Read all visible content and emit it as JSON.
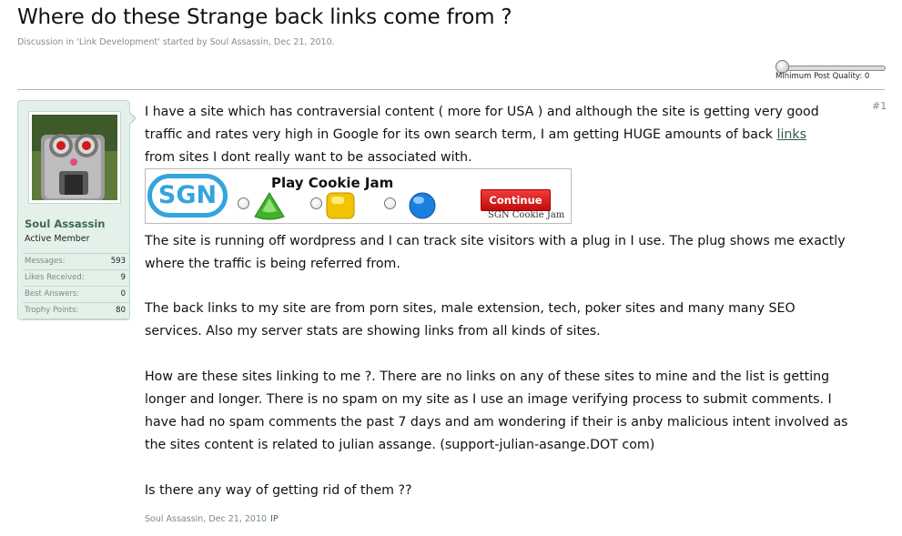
{
  "thread": {
    "title": "Where do these Strange back links come from ?",
    "subline": "Discussion in 'Link Development' started by Soul Assassin, Dec 21, 2010."
  },
  "quality_slider": {
    "label": "Minimum Post Quality: 0",
    "value": 0
  },
  "post": {
    "number": "#1",
    "author": {
      "name": "Soul Assassin",
      "title": "Active Member",
      "stats": [
        {
          "label": "Messages:",
          "value": "593"
        },
        {
          "label": "Likes Received:",
          "value": "9"
        },
        {
          "label": "Best Answers:",
          "value": "0"
        },
        {
          "label": "Trophy Points:",
          "value": "80"
        }
      ]
    },
    "para1_line1": "I have a site which has contraversial content ( more for USA ) and although the site is getting very good",
    "para1_line2_pre": "traffic and rates very high in Google for its own search term, I am getting HUGE amounts of back ",
    "para1_link": "links",
    "para1_line3": "from sites I dont really want to be associated with.",
    "ad": {
      "logo": "SGN",
      "title": "Play Cookie Jam",
      "button": "Continue",
      "caption": "SGN Cookie Jam",
      "colors": {
        "logo": "#34a4dc",
        "button": "#d91818"
      }
    },
    "para2_line1": "The site is running off wordpress and I can track site visitors with a plug in I use. The plug shows me exactly",
    "para2_line2": "where the traffic is being referred from.",
    "para3_line1": "The back links to my site are from porn sites, male extension, tech, poker sites and many many SEO",
    "para3_line2": "services. Also my server stats are showing links from all kinds of sites.",
    "para4_line1": "How are these sites linking to me ?. There are no links on any of these sites to mine and the list is getting",
    "para4_line2": "longer and longer. There is no spam on my site as I use an image verifying process to submit comments. I",
    "para4_line3": "have had no spam comments the past 7 days and am wondering if their is anby malicious intent involved as",
    "para4_line4": "the sites content is related to julian assange. (support-julian-asange.DOT com)",
    "para5": "Is there any way of getting rid of them ??",
    "footer_meta": "Soul Assassin, Dec 21, 2010",
    "footer_ip": "IP"
  },
  "colors": {
    "accent_green": "#3d6a52",
    "usercard_bg": "#e3f1ea",
    "divider": "#9fc0b4"
  }
}
